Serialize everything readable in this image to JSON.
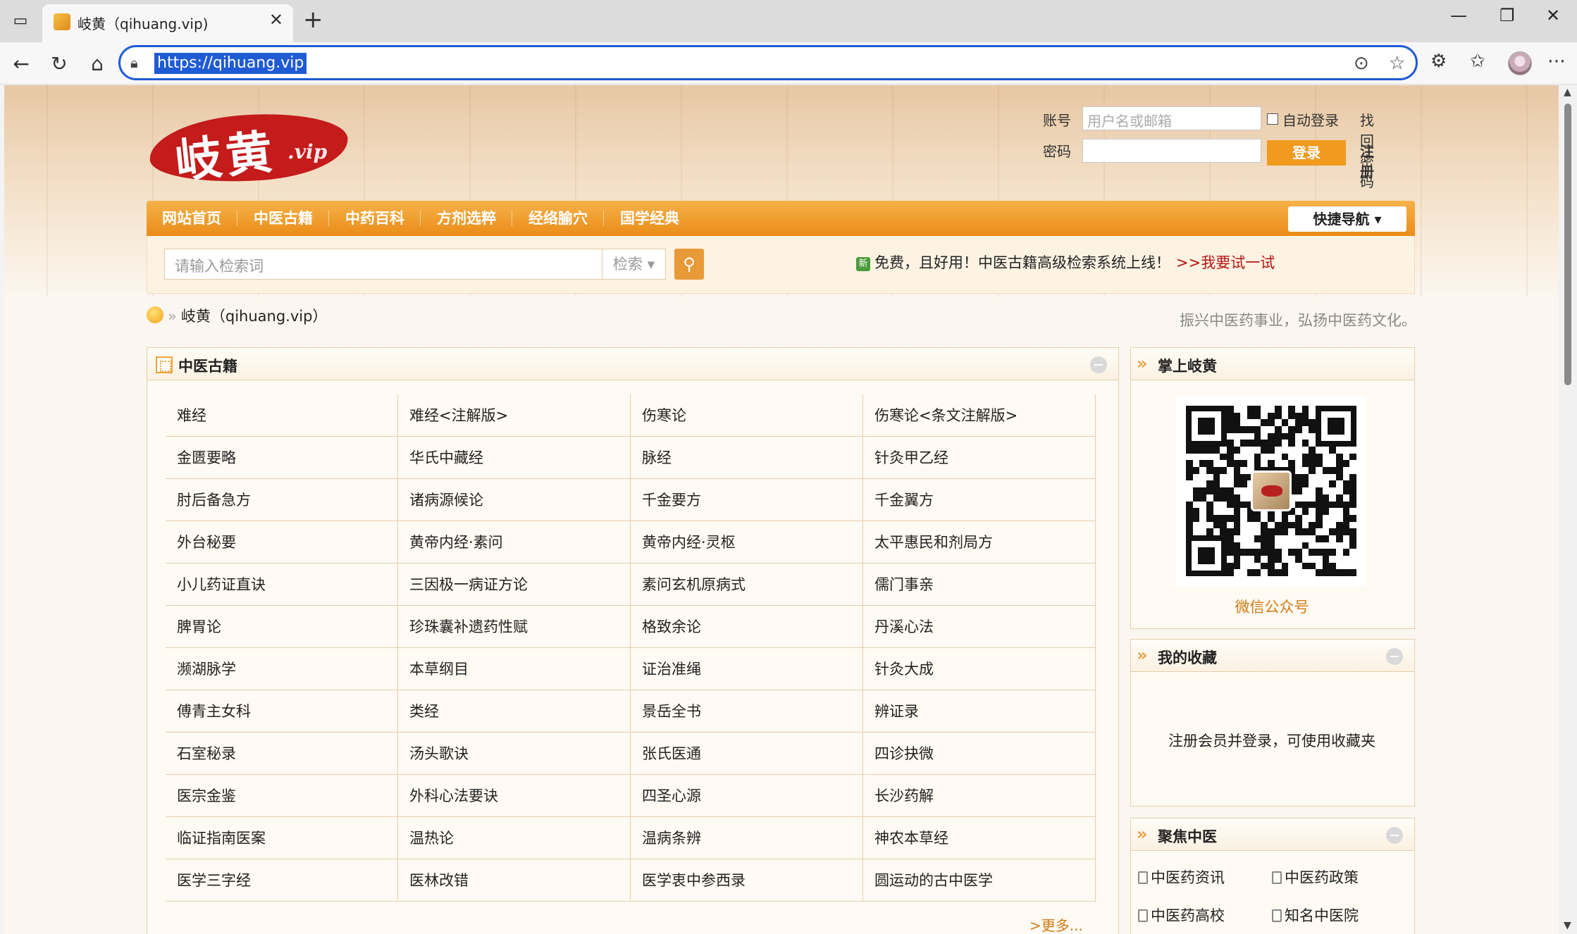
{
  "browser": {
    "tab_title": "岐黄（qihuang.vip)",
    "url": "https://qihuang.vip"
  },
  "site": {
    "logo_text": "岐黄",
    "logo_suffix": ".vip",
    "login": {
      "account_label": "账号",
      "account_placeholder": "用户名或邮箱",
      "password_label": "密码",
      "auto_login": "自动登录",
      "login_button": "登录",
      "recover": "找回密码",
      "register": "注册"
    },
    "nav": [
      "网站首页",
      "中医古籍",
      "中药百科",
      "方剂选粹",
      "经络腧穴",
      "国学经典"
    ],
    "quick_nav": "快捷导航",
    "search": {
      "placeholder": "请输入检索词",
      "select": "检索"
    },
    "promo": {
      "badge": "新",
      "text": "免费，且好用！中医古籍高级检索系统上线！",
      "link": ">>我要试一试"
    },
    "breadcrumb": "岐黄（qihuang.vip）",
    "slogan": "振兴中医药事业，弘扬中医药文化。"
  },
  "classics": {
    "title": "中医古籍",
    "rows": [
      [
        "难经",
        "难经<注解版>",
        "伤寒论",
        "伤寒论<条文注解版>"
      ],
      [
        "金匮要略",
        "华氏中藏经",
        "脉经",
        "针灸甲乙经"
      ],
      [
        "肘后备急方",
        "诸病源候论",
        "千金要方",
        "千金翼方"
      ],
      [
        "外台秘要",
        "黄帝内经·素问",
        "黄帝内经·灵枢",
        "太平惠民和剂局方"
      ],
      [
        "小儿药证直诀",
        "三因极一病证方论",
        "素问玄机原病式",
        "儒门事亲"
      ],
      [
        "脾胃论",
        "珍珠囊补遗药性赋",
        "格致余论",
        "丹溪心法"
      ],
      [
        "濒湖脉学",
        "本草纲目",
        "证治准绳",
        "针灸大成"
      ],
      [
        "傅青主女科",
        "类经",
        "景岳全书",
        "辨证录"
      ],
      [
        "石室秘录",
        "汤头歌诀",
        "张氏医通",
        "四诊抉微"
      ],
      [
        "医宗金鉴",
        "外科心法要诀",
        "四圣心源",
        "长沙药解"
      ],
      [
        "临证指南医案",
        "温热论",
        "温病条辨",
        "神农本草经"
      ],
      [
        "医学三字经",
        "医林改错",
        "医学衷中参西录",
        "圆运动的古中医学"
      ]
    ],
    "more": ">更多..."
  },
  "sidebar": {
    "mobile": {
      "title": "掌上岐黄",
      "caption": "微信公众号"
    },
    "favorites": {
      "title": "我的收藏",
      "text": "注册会员并登录，可使用收藏夹"
    },
    "focus": {
      "title": "聚焦中医",
      "links": [
        "中医药资讯",
        "中医药政策",
        "中医药高校",
        "知名中医院"
      ]
    }
  },
  "colors": {
    "accent": "#ea8c18",
    "link_red": "#b61414",
    "border": "#e5cfab"
  }
}
